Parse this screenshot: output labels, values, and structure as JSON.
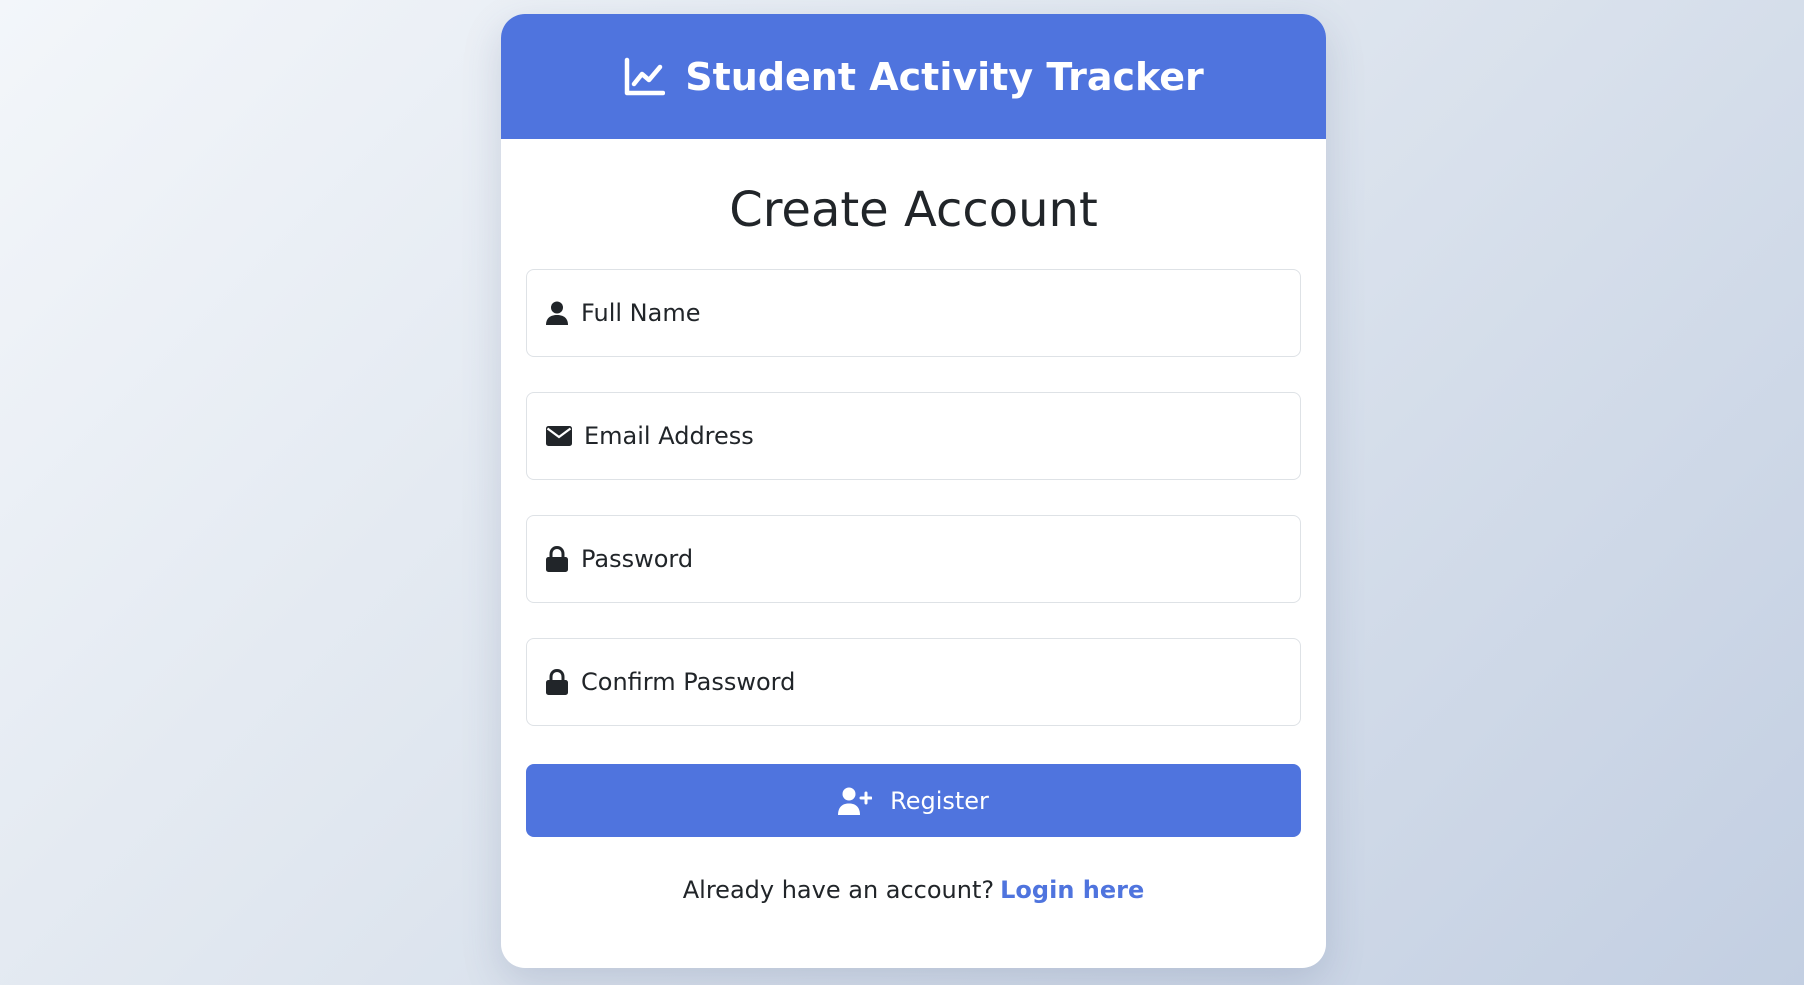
{
  "app": {
    "title": "Student Activity Tracker",
    "icon": "chart-line-icon"
  },
  "form": {
    "heading": "Create Account",
    "fields": [
      {
        "name": "full-name",
        "icon": "user-icon",
        "placeholder": "Full Name",
        "value": ""
      },
      {
        "name": "email",
        "icon": "envelope-icon",
        "placeholder": "Email Address",
        "value": ""
      },
      {
        "name": "password",
        "icon": "lock-icon",
        "placeholder": "Password",
        "value": ""
      },
      {
        "name": "confirm-password",
        "icon": "lock-icon",
        "placeholder": "Confirm Password",
        "value": ""
      }
    ],
    "submit_label": "Register",
    "submit_icon": "user-plus-icon"
  },
  "footer": {
    "prompt": "Already have an account?",
    "link_label": "Login here"
  },
  "colors": {
    "primary": "#4f74de",
    "text": "#212529",
    "border": "#dee2e6"
  }
}
